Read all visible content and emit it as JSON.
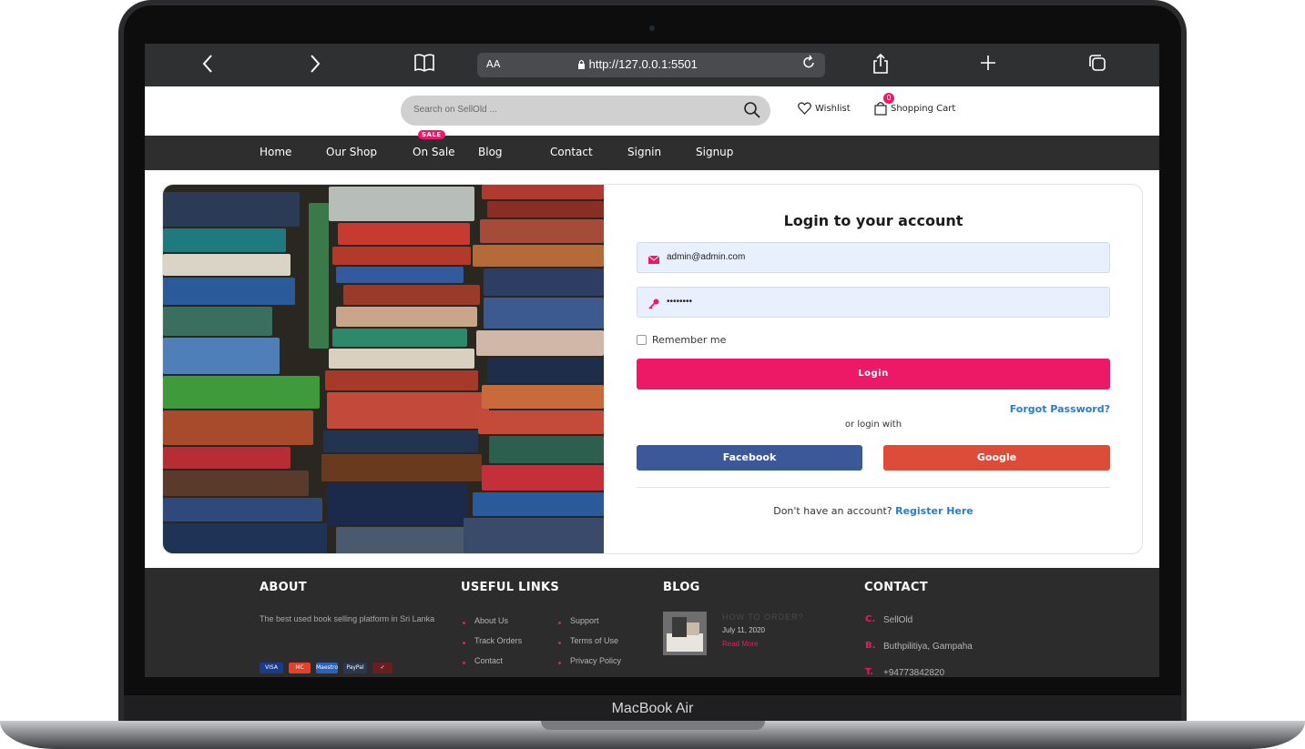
{
  "browser": {
    "back_icon": "chevron-left-icon",
    "forward_icon": "chevron-right-icon",
    "bookmarks_icon": "book-icon",
    "text_size": "AA",
    "url": "http://127.0.0.1:5501",
    "lock_icon": "lock-icon",
    "reload_icon": "reload-icon",
    "share_icon": "share-icon",
    "new_tab_icon": "plus-icon",
    "tabs_icon": "tabs-icon"
  },
  "header": {
    "search_placeholder": "Search on SellOld ...",
    "wishlist_label": "Wishlist",
    "cart_label": "Shopping Cart",
    "cart_count": "0"
  },
  "nav": {
    "items": [
      {
        "label": "Home"
      },
      {
        "label": "Our Shop"
      },
      {
        "label": "On Sale"
      },
      {
        "label": "Blog"
      },
      {
        "label": "Contact"
      },
      {
        "label": "Signin"
      },
      {
        "label": "Signup"
      }
    ],
    "sale_badge": "SALE"
  },
  "login": {
    "title": "Login to your account",
    "email_value": "admin@admin.com",
    "password_value": "••••••••",
    "remember_label": "Remember me",
    "login_button": "Login",
    "forgot_link": "Forgot Password?",
    "or_login_with": "or login with",
    "facebook_button": "Facebook",
    "google_button": "Google",
    "no_account_text": "Don't have an account?",
    "register_link": "Register Here"
  },
  "footer": {
    "about": {
      "heading": "ABOUT",
      "text": "The best used book selling platform in Sri Lanka",
      "payments": [
        "VISA",
        "MC",
        "Maestro",
        "PayPal",
        "✓"
      ]
    },
    "links": {
      "heading": "USEFUL LINKS",
      "col1": [
        "About Us",
        "Track Orders",
        "Contact"
      ],
      "col2": [
        "Support",
        "Terms of Use",
        "Privacy Policy"
      ]
    },
    "blog": {
      "heading": "BLOG",
      "post_title": "HOW TO ORDER?",
      "post_date": "July 11, 2020",
      "read_more": "Read More"
    },
    "contact": {
      "heading": "CONTACT",
      "items": [
        {
          "letter": "C.",
          "text": "SellOld"
        },
        {
          "letter": "B.",
          "text": "Buthpilitiya, Gampaha"
        },
        {
          "letter": "T.",
          "text": "+94773842820"
        }
      ]
    }
  },
  "device": {
    "label": "MacBook Air"
  },
  "colors": {
    "accent": "#ed1866",
    "link": "#2a7cc7",
    "facebook": "#3b5998",
    "google": "#dd4b39",
    "dark_bar": "#2e2e2e"
  }
}
